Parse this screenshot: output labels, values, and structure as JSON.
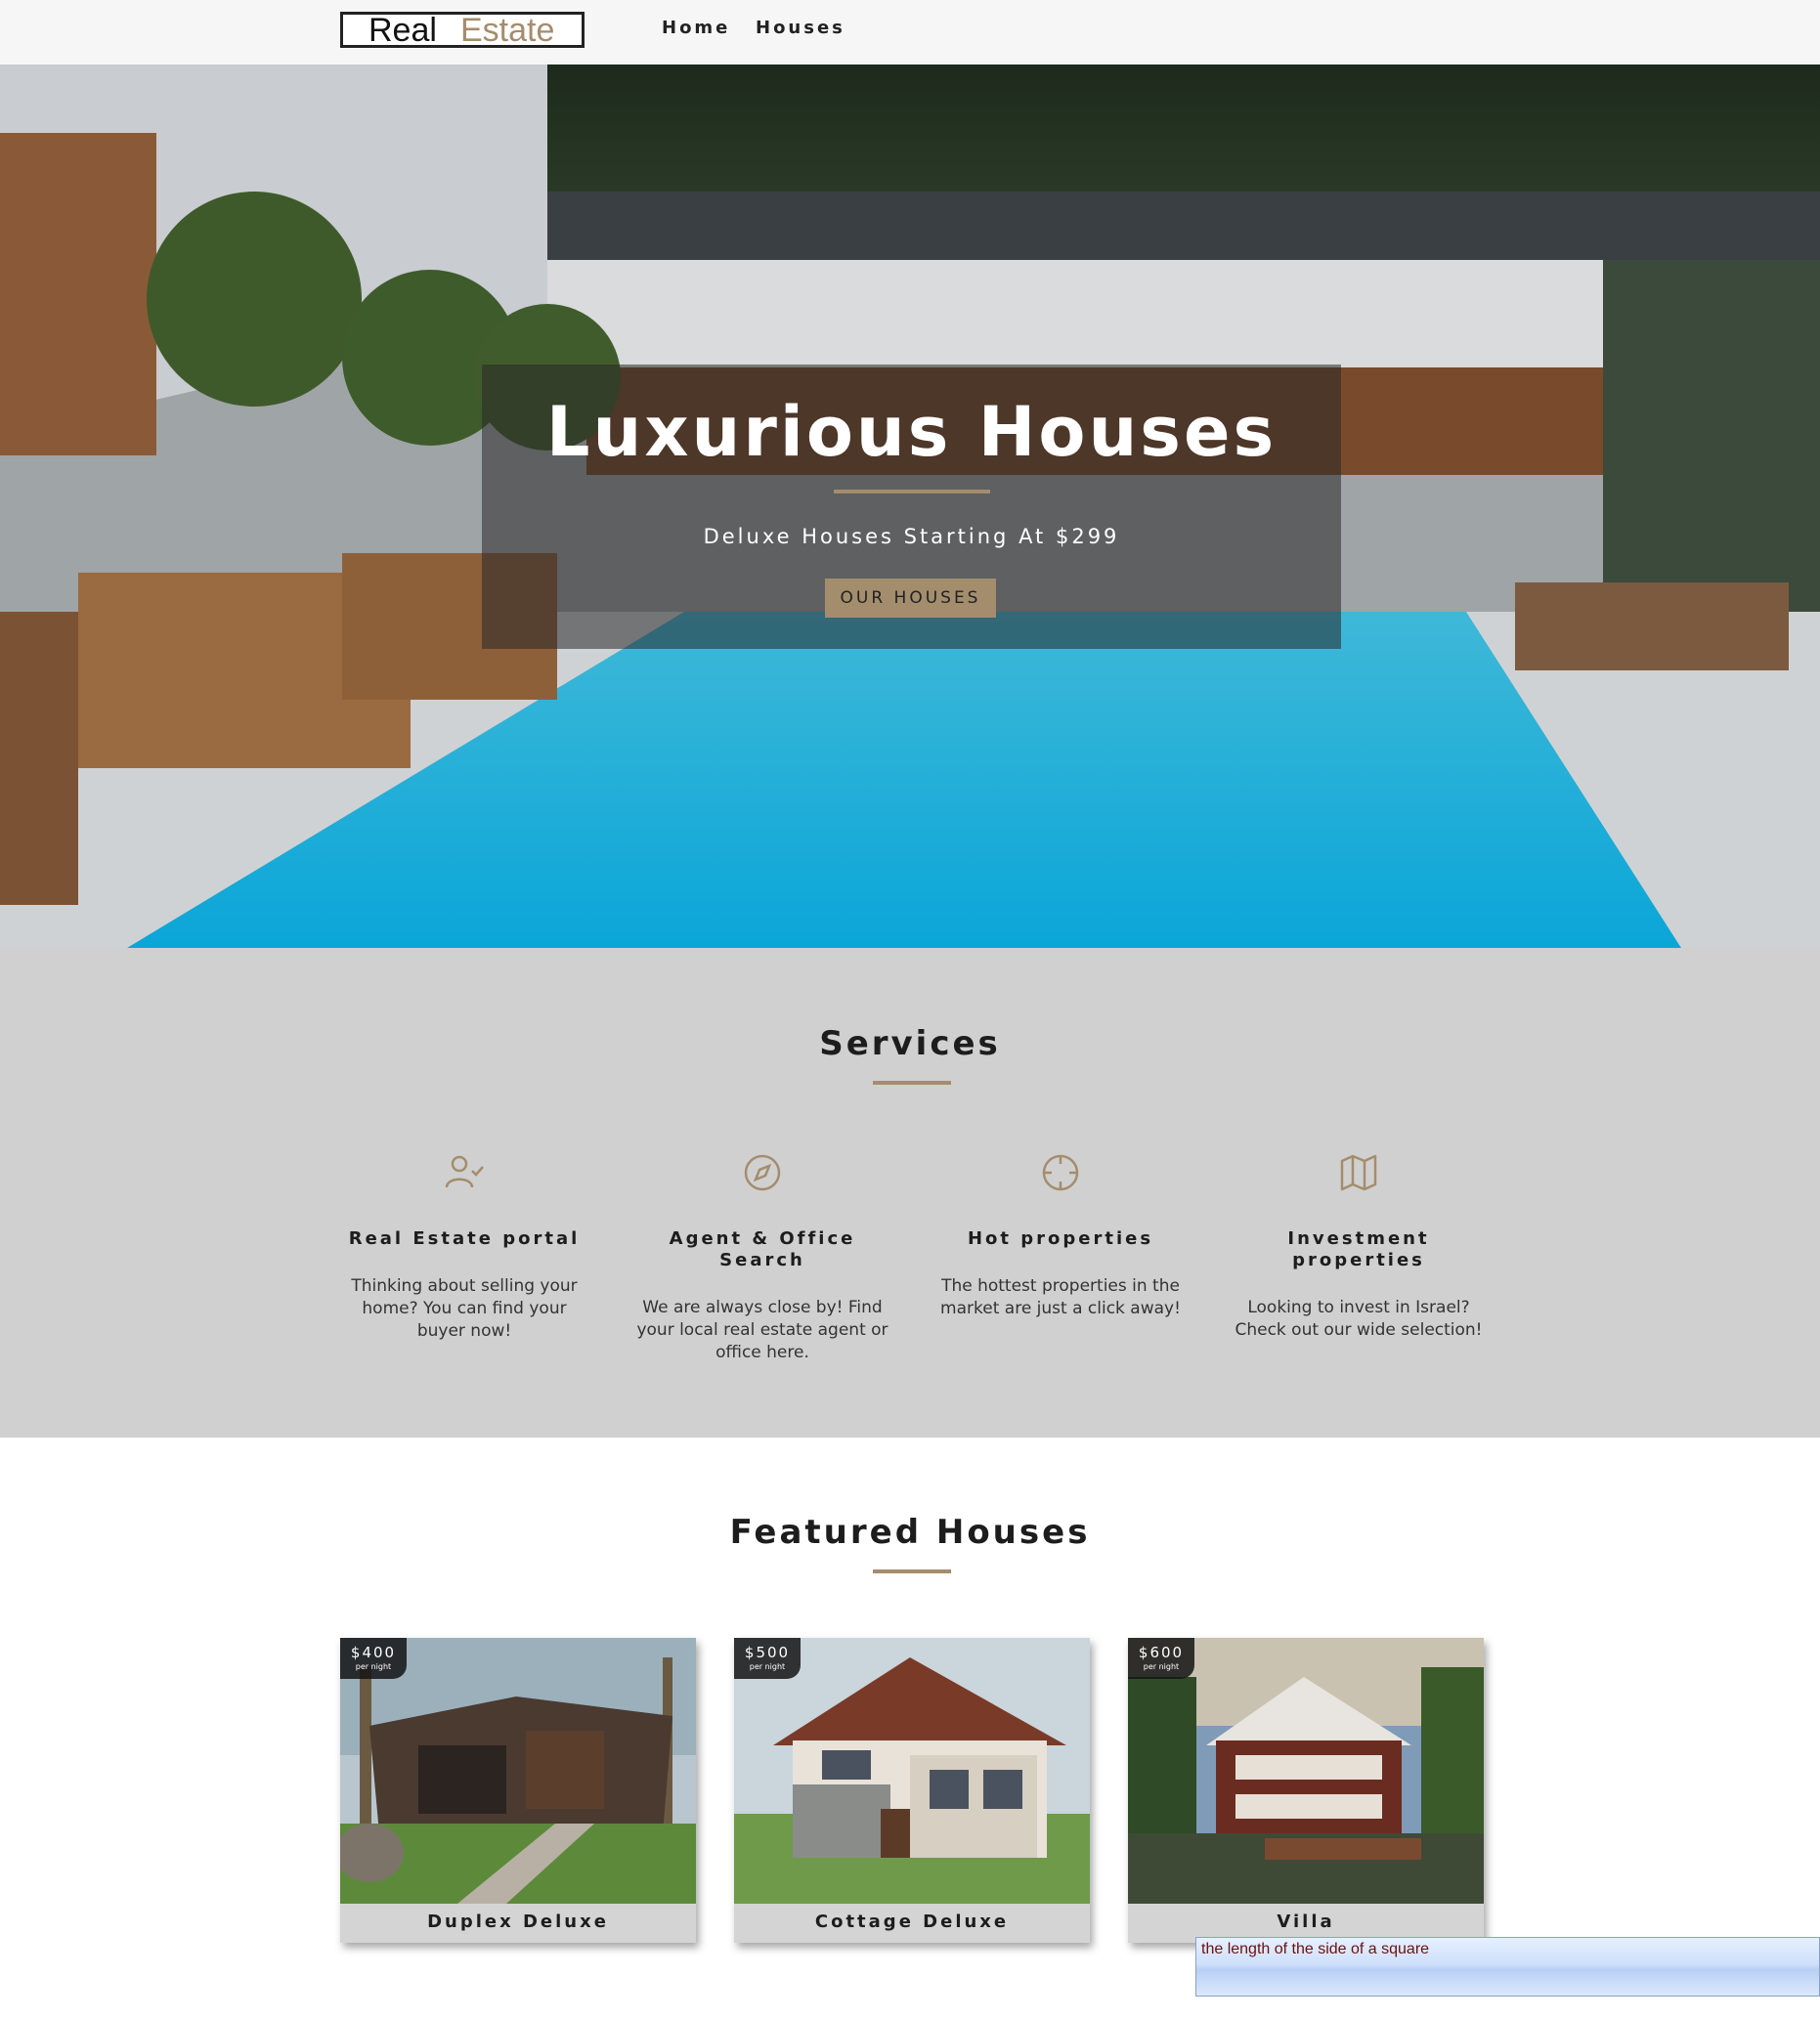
{
  "nav": {
    "logo_part1": "Real",
    "logo_part2": "Estate",
    "links": [
      "Home",
      "Houses"
    ]
  },
  "hero": {
    "title": "Luxurious Houses",
    "subtitle": "Deluxe Houses Starting At $299",
    "button": "OUR HOUSES"
  },
  "services": {
    "title": "Services",
    "items": [
      {
        "icon": "user-check-icon",
        "title": "Real Estate portal",
        "text": "Thinking about selling your home? You can find your buyer now!"
      },
      {
        "icon": "compass-icon",
        "title": "Agent & Office Search",
        "text": "We are always close by! Find your local real estate agent or office here."
      },
      {
        "icon": "crosshair-icon",
        "title": "Hot properties",
        "text": "The hottest properties in the market are just a click away!"
      },
      {
        "icon": "map-icon",
        "title": "Investment properties",
        "text": "Looking to invest in Israel? Check out our wide selection!"
      }
    ]
  },
  "featured": {
    "title": "Featured Houses",
    "houses": [
      {
        "price": "$400",
        "per": "per night",
        "name": "Duplex Deluxe"
      },
      {
        "price": "$500",
        "per": "per night",
        "name": "Cottage Deluxe"
      },
      {
        "price": "$600",
        "per": "per night",
        "name": "Villa"
      }
    ]
  },
  "tooltip": {
    "text": "the length of the side of a square"
  },
  "colors": {
    "accent": "#a48d6d",
    "nav_bg": "#f6f6f6",
    "services_bg": "#d0d0d0"
  }
}
